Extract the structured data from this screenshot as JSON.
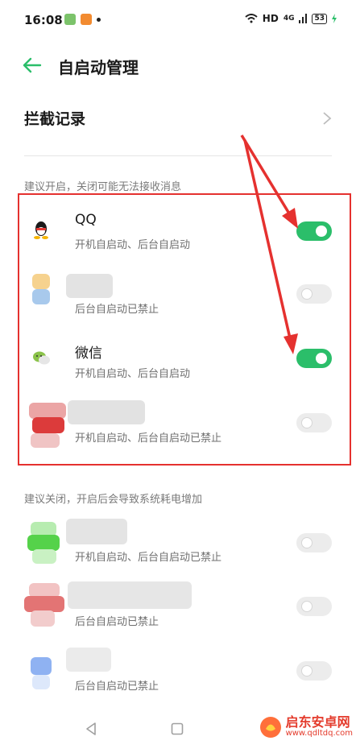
{
  "status_bar": {
    "time": "16:08",
    "network": "HD",
    "signal": "4G",
    "battery": "53"
  },
  "header": {
    "title": "自启动管理"
  },
  "intercept": {
    "label": "拦截记录"
  },
  "section_recommend_on": {
    "label": "建议开启，关闭可能无法接收消息",
    "apps": [
      {
        "name": "QQ",
        "status": "开机自启动、后台自启动",
        "enabled": true
      },
      {
        "name": "",
        "status": "后台自启动已禁止",
        "enabled": false
      },
      {
        "name": "微信",
        "status": "开机自启动、后台自启动",
        "enabled": true
      },
      {
        "name": "",
        "status": "开机自启动、后台自启动已禁止",
        "enabled": false
      }
    ]
  },
  "section_recommend_off": {
    "label": "建议关闭，开启后会导致系统耗电增加",
    "apps": [
      {
        "name": "",
        "status": "开机自启动、后台自启动已禁止",
        "enabled": false
      },
      {
        "name": "",
        "status": "后台自启动已禁止",
        "enabled": false
      },
      {
        "name": "",
        "status": "后台自启动已禁止",
        "enabled": false
      }
    ]
  },
  "watermark": {
    "name": "启东安卓网",
    "url": "www.qdltdq.com"
  },
  "colors": {
    "accent": "#2bbe6a",
    "highlight": "#e5312f"
  }
}
